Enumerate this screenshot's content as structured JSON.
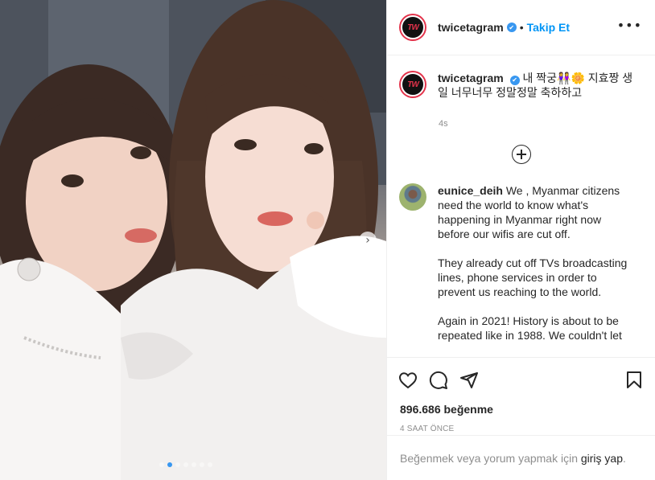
{
  "post": {
    "username": "twicetagram",
    "verified_mark": "✔",
    "separator": "•",
    "follow_label": "Takip Et",
    "more_icon": "•••",
    "avatar_text": "TW"
  },
  "caption": {
    "username": "twicetagram",
    "text": "내 짝궁👭🌼 지효짱 생일 너무너무 정말정말 축하하고",
    "age": "4s"
  },
  "comments": [
    {
      "username": "eunice_deih",
      "paragraphs": [
        "We , Myanmar citizens need the world to know what's happening in Myanmar right now before our wifis are cut off.",
        "They already cut off TVs broadcasting lines, phone services in order to prevent us reaching to the world.",
        "Again in 2021! History is about to be repeated like in 1988. We couldn't let"
      ]
    }
  ],
  "stats": {
    "likes": "896.686 beğenme",
    "timestamp": "4 SAAT ÖNCE"
  },
  "login_prompt": {
    "text": "Beğenmek veya yorum yapmak için ",
    "link": "giriş yap",
    "suffix": "."
  },
  "carousel": {
    "next_icon": "›",
    "slide_count": 7,
    "active_slide": 1
  },
  "icons": {
    "like": "heart-icon",
    "comment": "comment-icon",
    "share": "share-icon",
    "save": "bookmark-icon",
    "load_more": "plus-circle-icon"
  },
  "colors": {
    "accent": "#0095f6",
    "verified": "#3897f0",
    "text": "#262626",
    "muted": "#8e8e8e",
    "divider": "#efefef"
  }
}
